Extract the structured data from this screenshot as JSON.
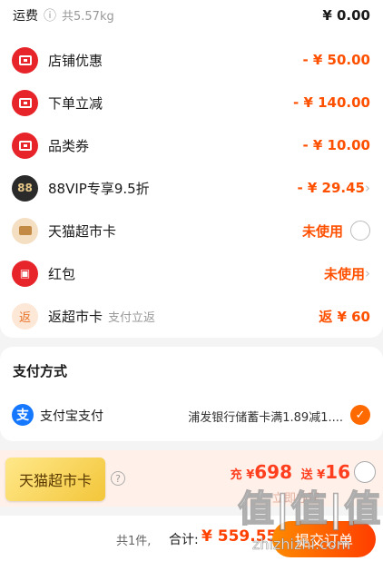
{
  "shipping": {
    "label": "运费",
    "weight": "共5.57kg",
    "amount": "¥ 0.00"
  },
  "discounts": [
    {
      "label": "店铺优惠",
      "amount": "- ¥ 50.00",
      "icon": "shop-coupon-icon"
    },
    {
      "label": "下单立减",
      "amount": "- ¥ 140.00",
      "icon": "instant-discount-icon"
    },
    {
      "label": "品类券",
      "amount": "- ¥ 10.00",
      "icon": "category-coupon-icon"
    },
    {
      "label": "88VIP专享9.5折",
      "amount": "- ¥ 29.45",
      "icon": "88vip-icon"
    },
    {
      "label": "天猫超市卡",
      "amount": "未使用",
      "icon": "tmall-card-icon"
    },
    {
      "label": "红包",
      "amount": "未使用",
      "icon": "red-packet-icon"
    },
    {
      "label": "返超市卡",
      "sub": "支付立返",
      "amount": "返 ¥ 60",
      "icon": "rebate-icon"
    }
  ],
  "payment": {
    "title": "支付方式",
    "method": "支付宝支付",
    "promo": "浦发银行储蓄卡满1.89减1....",
    "alipay_glyph": "支"
  },
  "promo_bar": {
    "card_label": "天猫超市卡",
    "help": "?",
    "charge_prefix": "充 ¥",
    "charge_amount": "698",
    "gift_prefix": "送 ¥",
    "gift_amount": "16",
    "ghost_text": "立即办理"
  },
  "footer": {
    "count": "共1件,",
    "total_label": "合计:",
    "total_value": "¥ 559.55",
    "submit": "提交订单"
  },
  "watermark": {
    "main": "值|值|值",
    "sub": "zhizhizhi.com"
  },
  "icons": {
    "rebate_glyph": "返",
    "red_packet_glyph": "▣",
    "vip_glyph": "88"
  },
  "colors": {
    "accent": "#ff5000",
    "alipay": "#1678ff",
    "card_gold": "#f3c63a"
  }
}
